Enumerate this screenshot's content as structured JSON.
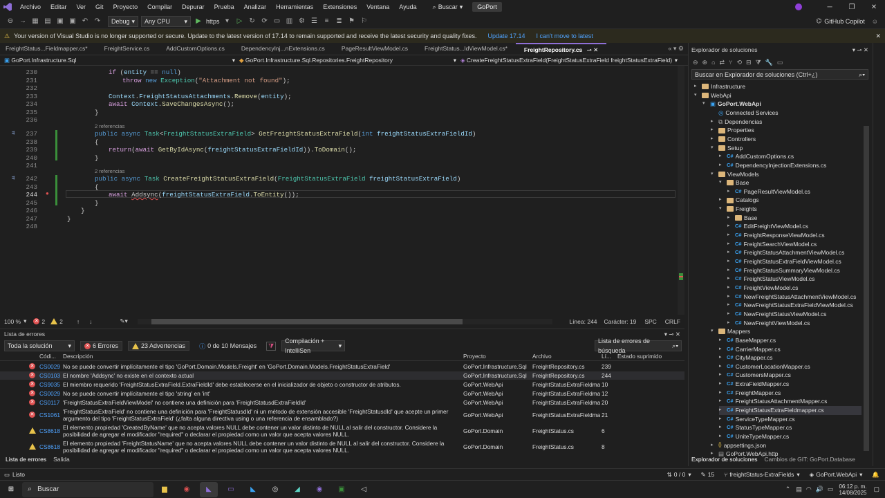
{
  "menubar": {
    "items": [
      "Archivo",
      "Editar",
      "Ver",
      "Git",
      "Proyecto",
      "Compilar",
      "Depurar",
      "Prueba",
      "Analizar",
      "Herramientas",
      "Extensiones",
      "Ventana",
      "Ayuda"
    ],
    "search": "Buscar",
    "solution": "GoPort"
  },
  "toolbar": {
    "config": "Debug",
    "platform": "Any CPU",
    "run": "https",
    "copilot": "GitHub Copilot"
  },
  "infobar": {
    "message": "Your version of Visual Studio is no longer supported or secure. Update to the latest version of 17.14 to remain supported and receive the latest security and quality fixes.",
    "update": "Update 17.14",
    "dismiss": "I can't move to latest"
  },
  "tabs": [
    "FreightStatus...Fieldmapper.cs*",
    "FreightService.cs",
    "AddCustomOptions.cs",
    "DependencyInj...nExtensions.cs",
    "PageResultViewModel.cs",
    "FreightStatus...ldViewModel.cs*",
    "FreightRepository.cs"
  ],
  "navbar": {
    "project": "GoPort.Infrastructure.Sql",
    "class": "GoPort.Infrastructure.Sql.Repositories.FreightRepository",
    "member": "CreateFreightStatusExtraField(FreightStatusExtraField freightStatusExtraField)"
  },
  "code": {
    "l230": "230",
    "l231": "231",
    "l232": "232",
    "l233": "233",
    "l234": "234",
    "l235": "235",
    "l236": "236",
    "l237": "237",
    "l238": "238",
    "l239": "239",
    "l240": "240",
    "l241": "241",
    "l242": "242",
    "l243": "243",
    "l244": "244",
    "l245": "245",
    "l246": "246",
    "l247": "247",
    "l248": "248",
    "refs1": "2 referencias",
    "refs2": "2 referencias"
  },
  "editor_status": {
    "zoom": "100 %",
    "errors": "2",
    "warnings": "2",
    "line": "Línea: 244",
    "col": "Carácter: 19",
    "spc": "SPC",
    "crlf": "CRLF"
  },
  "errors_panel": {
    "title": "Lista de errores",
    "scope": "Toda la solución",
    "errors": "6 Errores",
    "warnings": "23 Advertencias",
    "messages": "0 de 10 Mensajes",
    "build": "Compilación + IntelliSen",
    "search": "Lista de errores de búsqueda",
    "headers": {
      "code": "Códi...",
      "desc": "Descripción",
      "project": "Proyecto",
      "file": "Archivo",
      "line": "Lí...",
      "state": "Estado suprimido"
    },
    "rows": [
      {
        "type": "error",
        "code": "CS0029",
        "desc": "No se puede convertir implícitamente el tipo 'GoPort.Domain.Models.Freight' en 'GoPort.Domain.Models.FreightStatusExtraField'",
        "project": "GoPort.Infrastructure.Sql",
        "file": "FreightRepository.cs",
        "line": "239"
      },
      {
        "type": "error",
        "code": "CS0103",
        "desc": "El nombre 'Addsync' no existe en el contexto actual",
        "project": "GoPort.Infrastructure.Sql",
        "file": "FreightRepository.cs",
        "line": "244"
      },
      {
        "type": "error",
        "code": "CS9035",
        "desc": "El miembro requerido 'FreightStatusExtraField.ExtraFieldId' debe establecerse en el inicializador de objeto o constructor de atributos.",
        "project": "GoPort.WebApi",
        "file": "FreightStatusExtraFieldma...",
        "line": "10"
      },
      {
        "type": "error",
        "code": "CS0029",
        "desc": "No se puede convertir implícitamente el tipo 'string' en 'int'",
        "project": "GoPort.WebApi",
        "file": "FreightStatusExtraFieldma...",
        "line": "12"
      },
      {
        "type": "error",
        "code": "CS0117",
        "desc": "'FreightStatusExtraFieldViewModel' no contiene una definición para 'FreightStatusdExtraFieldId'",
        "project": "GoPort.WebApi",
        "file": "FreightStatusExtraFieldma...",
        "line": "20"
      },
      {
        "type": "error",
        "code": "CS1061",
        "desc": "'FreightStatusExtraField' no contiene una definición para 'FreightStatusdId' ni un método de extensión accesible 'FreightStatusdId' que acepte un primer argumento del tipo 'FreightStatusExtraField' (¿falta alguna directiva using o una referencia de ensamblado?)",
        "project": "GoPort.WebApi",
        "file": "FreightStatusExtraFieldma...",
        "line": "21"
      },
      {
        "type": "warning",
        "code": "CS8618",
        "desc": "El elemento propiedad 'CreatedByName' que no acepta valores NULL debe contener un valor distinto de NULL al salir del constructor. Considere la posibilidad de agregar el modificador \"required\" o declarar el propiedad como un valor que acepta valores NULL.",
        "project": "GoPort.Domain",
        "file": "FreightStatus.cs",
        "line": "6"
      },
      {
        "type": "warning",
        "code": "CS8618",
        "desc": "El elemento propiedad 'FreightStatusName' que no acepta valores NULL debe contener un valor distinto de NULL al salir del constructor. Considere la posibilidad de agregar el modificador \"required\" o declarar el propiedad como un valor que acepta valores NULL.",
        "project": "GoPort.Domain",
        "file": "FreightStatus.cs",
        "line": "8"
      }
    ],
    "bottom_tabs": [
      "Lista de errores",
      "Salida"
    ]
  },
  "solution_explorer": {
    "title": "Explorador de soluciones",
    "search": "Buscar en Explorador de soluciones (Ctrl+¿)",
    "items": [
      {
        "label": "Infrastructure",
        "kind": "folder",
        "indent": 0
      },
      {
        "label": "WebApi",
        "kind": "folder",
        "indent": 0
      },
      {
        "label": "GoPort.WebApi",
        "kind": "project",
        "indent": 1
      },
      {
        "label": "Connected Services",
        "kind": "service",
        "indent": 2
      },
      {
        "label": "Dependencias",
        "kind": "deps",
        "indent": 2
      },
      {
        "label": "Properties",
        "kind": "folder",
        "indent": 2
      },
      {
        "label": "Controllers",
        "kind": "folder",
        "indent": 2
      },
      {
        "label": "Setup",
        "kind": "folder",
        "indent": 2
      },
      {
        "label": "AddCustomOptions.cs",
        "kind": "cs",
        "indent": 3
      },
      {
        "label": "DependencyInjectionExtensions.cs",
        "kind": "cs",
        "indent": 3
      },
      {
        "label": "ViewModels",
        "kind": "folder",
        "indent": 2
      },
      {
        "label": "Base",
        "kind": "folder",
        "indent": 3
      },
      {
        "label": "PageResultViewModel.cs",
        "kind": "cs",
        "indent": 4
      },
      {
        "label": "Catalogs",
        "kind": "folder",
        "indent": 3
      },
      {
        "label": "Freights",
        "kind": "folder",
        "indent": 3
      },
      {
        "label": "Base",
        "kind": "folder",
        "indent": 4
      },
      {
        "label": "EditFreightViewModel.cs",
        "kind": "cs",
        "indent": 4
      },
      {
        "label": "FreightResponseViewModel.cs",
        "kind": "cs",
        "indent": 4
      },
      {
        "label": "FreightSearchViewModel.cs",
        "kind": "cs",
        "indent": 4
      },
      {
        "label": "FreightStatusAttachmentViewModel.cs",
        "kind": "cs",
        "indent": 4
      },
      {
        "label": "FreightStatusExtraFieldViewModel.cs",
        "kind": "cs",
        "indent": 4
      },
      {
        "label": "FreightStatusSummaryViewModel.cs",
        "kind": "cs",
        "indent": 4
      },
      {
        "label": "FreightStatusViewModel.cs",
        "kind": "cs",
        "indent": 4
      },
      {
        "label": "FreightViewModel.cs",
        "kind": "cs",
        "indent": 4
      },
      {
        "label": "NewFreightStatusAttachmentViewModel.cs",
        "kind": "cs",
        "indent": 4
      },
      {
        "label": "NewFreightStatusExtraFieldViewModel.cs",
        "kind": "cs",
        "indent": 4
      },
      {
        "label": "NewFreightStatusViewModel.cs",
        "kind": "cs",
        "indent": 4
      },
      {
        "label": "NewFreightViewModel.cs",
        "kind": "cs",
        "indent": 4
      },
      {
        "label": "Mappers",
        "kind": "folder",
        "indent": 2
      },
      {
        "label": "BaseMapper.cs",
        "kind": "cs",
        "indent": 3
      },
      {
        "label": "CarrierMapper.cs",
        "kind": "cs",
        "indent": 3
      },
      {
        "label": "CityMapper.cs",
        "kind": "cs",
        "indent": 3
      },
      {
        "label": "CustomerLocationMapper.cs",
        "kind": "cs",
        "indent": 3
      },
      {
        "label": "CustomersMapper.cs",
        "kind": "cs",
        "indent": 3
      },
      {
        "label": "ExtraFieldMapper.cs",
        "kind": "cs",
        "indent": 3
      },
      {
        "label": "FreightMapper.cs",
        "kind": "cs",
        "indent": 3
      },
      {
        "label": "FreightStatusAttachmentMapper.cs",
        "kind": "cs",
        "indent": 3
      },
      {
        "label": "FreightStatusExtraFieldmapper.cs",
        "kind": "cs",
        "indent": 3
      },
      {
        "label": "ServiceTypeMapper.cs",
        "kind": "cs",
        "indent": 3
      },
      {
        "label": "StatusTypeMapper.cs",
        "kind": "cs",
        "indent": 3
      },
      {
        "label": "UniteTypeMapper.cs",
        "kind": "cs",
        "indent": 3
      },
      {
        "label": "appsettings.json",
        "kind": "json",
        "indent": 2
      },
      {
        "label": "GoPort.WebApi.http",
        "kind": "http",
        "indent": 2
      }
    ],
    "bottom_tabs": [
      "Explorador de soluciones",
      "Cambios de GIT: GoPort.Database"
    ]
  },
  "statusbar": {
    "ready": "Listo",
    "changes": "0 / 0",
    "commits": "15",
    "branch": "freightStatus-ExtraFields",
    "repo": "GoPort.WebApi"
  },
  "taskbar": {
    "search": "Buscar",
    "time": "06:12 p. m.",
    "date": "14/08/2025"
  }
}
